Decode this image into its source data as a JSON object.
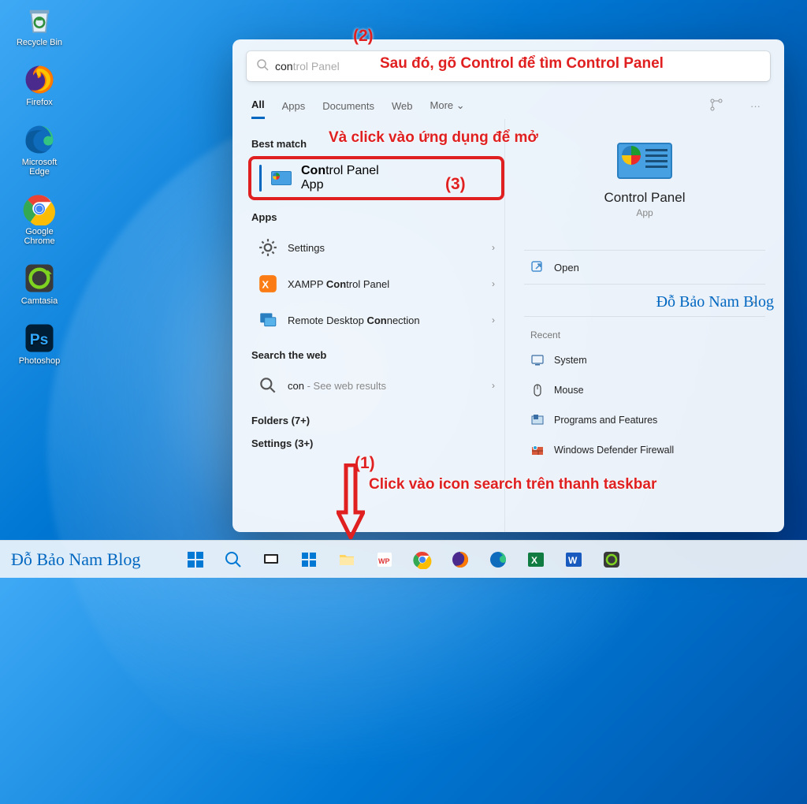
{
  "desktop": {
    "icons": [
      {
        "id": "recycle-bin",
        "label": "Recycle Bin"
      },
      {
        "id": "firefox",
        "label": "Firefox"
      },
      {
        "id": "edge",
        "label": "Microsoft Edge"
      },
      {
        "id": "chrome",
        "label": "Google Chrome"
      },
      {
        "id": "camtasia",
        "label": "Camtasia"
      },
      {
        "id": "photoshop",
        "label": "Photoshop"
      }
    ]
  },
  "search": {
    "typed_prefix": "con",
    "typed_hint": "trol Panel",
    "tabs": {
      "all": "All",
      "apps": "Apps",
      "documents": "Documents",
      "web": "Web",
      "more": "More"
    },
    "best_match_head": "Best match",
    "best_match": {
      "title_prefix": "Con",
      "title_rest": "trol Panel",
      "sub": "App"
    },
    "apps_head": "Apps",
    "apps": {
      "settings": "Settings",
      "xampp_prefix": "XAMPP ",
      "xampp_bold": "Con",
      "xampp_rest": "trol Panel",
      "rdc_prefix": "Remote Desktop ",
      "rdc_bold": "Con",
      "rdc_rest": "nection"
    },
    "search_web_head": "Search the web",
    "web_prefix": "con",
    "web_rest": " - See web results",
    "folders_head": "Folders (7+)",
    "settings_head": "Settings (3+)"
  },
  "preview": {
    "title": "Control Panel",
    "sub": "App",
    "open": "Open",
    "recent_head": "Recent",
    "recent": {
      "system": "System",
      "mouse": "Mouse",
      "programs": "Programs and Features",
      "firewall": "Windows Defender Firewall"
    }
  },
  "taskbar": {
    "brand": "Đỗ Bảo Nam Blog"
  },
  "annotations": {
    "n1": "(1)",
    "n2": "(2)",
    "n3": "(3)",
    "line1": "Click vào icon search trên thanh taskbar",
    "line2": "Sau đó, gõ Control để tìm Control Panel",
    "line3": "Và click vào ứng dụng để mở",
    "watermark": "Đỗ Bảo Nam Blog"
  }
}
